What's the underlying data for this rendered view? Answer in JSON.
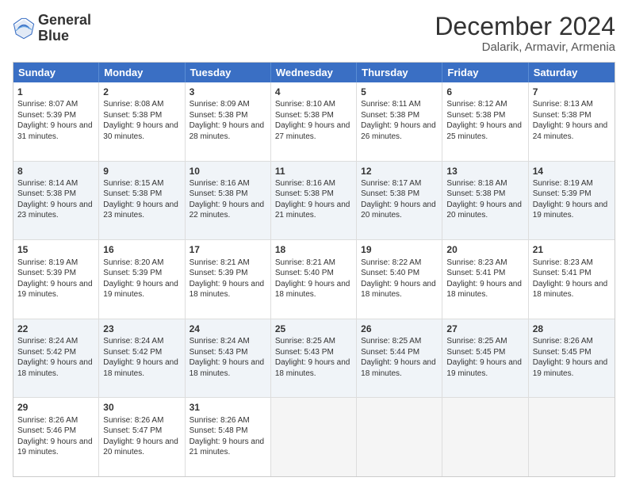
{
  "header": {
    "logo_line1": "General",
    "logo_line2": "Blue",
    "main_title": "December 2024",
    "subtitle": "Dalarik, Armavir, Armenia"
  },
  "calendar": {
    "days_of_week": [
      "Sunday",
      "Monday",
      "Tuesday",
      "Wednesday",
      "Thursday",
      "Friday",
      "Saturday"
    ],
    "rows": [
      [
        {
          "day": "1",
          "sunrise": "Sunrise: 8:07 AM",
          "sunset": "Sunset: 5:39 PM",
          "daylight": "Daylight: 9 hours and 31 minutes."
        },
        {
          "day": "2",
          "sunrise": "Sunrise: 8:08 AM",
          "sunset": "Sunset: 5:38 PM",
          "daylight": "Daylight: 9 hours and 30 minutes."
        },
        {
          "day": "3",
          "sunrise": "Sunrise: 8:09 AM",
          "sunset": "Sunset: 5:38 PM",
          "daylight": "Daylight: 9 hours and 28 minutes."
        },
        {
          "day": "4",
          "sunrise": "Sunrise: 8:10 AM",
          "sunset": "Sunset: 5:38 PM",
          "daylight": "Daylight: 9 hours and 27 minutes."
        },
        {
          "day": "5",
          "sunrise": "Sunrise: 8:11 AM",
          "sunset": "Sunset: 5:38 PM",
          "daylight": "Daylight: 9 hours and 26 minutes."
        },
        {
          "day": "6",
          "sunrise": "Sunrise: 8:12 AM",
          "sunset": "Sunset: 5:38 PM",
          "daylight": "Daylight: 9 hours and 25 minutes."
        },
        {
          "day": "7",
          "sunrise": "Sunrise: 8:13 AM",
          "sunset": "Sunset: 5:38 PM",
          "daylight": "Daylight: 9 hours and 24 minutes."
        }
      ],
      [
        {
          "day": "8",
          "sunrise": "Sunrise: 8:14 AM",
          "sunset": "Sunset: 5:38 PM",
          "daylight": "Daylight: 9 hours and 23 minutes."
        },
        {
          "day": "9",
          "sunrise": "Sunrise: 8:15 AM",
          "sunset": "Sunset: 5:38 PM",
          "daylight": "Daylight: 9 hours and 23 minutes."
        },
        {
          "day": "10",
          "sunrise": "Sunrise: 8:16 AM",
          "sunset": "Sunset: 5:38 PM",
          "daylight": "Daylight: 9 hours and 22 minutes."
        },
        {
          "day": "11",
          "sunrise": "Sunrise: 8:16 AM",
          "sunset": "Sunset: 5:38 PM",
          "daylight": "Daylight: 9 hours and 21 minutes."
        },
        {
          "day": "12",
          "sunrise": "Sunrise: 8:17 AM",
          "sunset": "Sunset: 5:38 PM",
          "daylight": "Daylight: 9 hours and 20 minutes."
        },
        {
          "day": "13",
          "sunrise": "Sunrise: 8:18 AM",
          "sunset": "Sunset: 5:38 PM",
          "daylight": "Daylight: 9 hours and 20 minutes."
        },
        {
          "day": "14",
          "sunrise": "Sunrise: 8:19 AM",
          "sunset": "Sunset: 5:39 PM",
          "daylight": "Daylight: 9 hours and 19 minutes."
        }
      ],
      [
        {
          "day": "15",
          "sunrise": "Sunrise: 8:19 AM",
          "sunset": "Sunset: 5:39 PM",
          "daylight": "Daylight: 9 hours and 19 minutes."
        },
        {
          "day": "16",
          "sunrise": "Sunrise: 8:20 AM",
          "sunset": "Sunset: 5:39 PM",
          "daylight": "Daylight: 9 hours and 19 minutes."
        },
        {
          "day": "17",
          "sunrise": "Sunrise: 8:21 AM",
          "sunset": "Sunset: 5:39 PM",
          "daylight": "Daylight: 9 hours and 18 minutes."
        },
        {
          "day": "18",
          "sunrise": "Sunrise: 8:21 AM",
          "sunset": "Sunset: 5:40 PM",
          "daylight": "Daylight: 9 hours and 18 minutes."
        },
        {
          "day": "19",
          "sunrise": "Sunrise: 8:22 AM",
          "sunset": "Sunset: 5:40 PM",
          "daylight": "Daylight: 9 hours and 18 minutes."
        },
        {
          "day": "20",
          "sunrise": "Sunrise: 8:23 AM",
          "sunset": "Sunset: 5:41 PM",
          "daylight": "Daylight: 9 hours and 18 minutes."
        },
        {
          "day": "21",
          "sunrise": "Sunrise: 8:23 AM",
          "sunset": "Sunset: 5:41 PM",
          "daylight": "Daylight: 9 hours and 18 minutes."
        }
      ],
      [
        {
          "day": "22",
          "sunrise": "Sunrise: 8:24 AM",
          "sunset": "Sunset: 5:42 PM",
          "daylight": "Daylight: 9 hours and 18 minutes."
        },
        {
          "day": "23",
          "sunrise": "Sunrise: 8:24 AM",
          "sunset": "Sunset: 5:42 PM",
          "daylight": "Daylight: 9 hours and 18 minutes."
        },
        {
          "day": "24",
          "sunrise": "Sunrise: 8:24 AM",
          "sunset": "Sunset: 5:43 PM",
          "daylight": "Daylight: 9 hours and 18 minutes."
        },
        {
          "day": "25",
          "sunrise": "Sunrise: 8:25 AM",
          "sunset": "Sunset: 5:43 PM",
          "daylight": "Daylight: 9 hours and 18 minutes."
        },
        {
          "day": "26",
          "sunrise": "Sunrise: 8:25 AM",
          "sunset": "Sunset: 5:44 PM",
          "daylight": "Daylight: 9 hours and 18 minutes."
        },
        {
          "day": "27",
          "sunrise": "Sunrise: 8:25 AM",
          "sunset": "Sunset: 5:45 PM",
          "daylight": "Daylight: 9 hours and 19 minutes."
        },
        {
          "day": "28",
          "sunrise": "Sunrise: 8:26 AM",
          "sunset": "Sunset: 5:45 PM",
          "daylight": "Daylight: 9 hours and 19 minutes."
        }
      ],
      [
        {
          "day": "29",
          "sunrise": "Sunrise: 8:26 AM",
          "sunset": "Sunset: 5:46 PM",
          "daylight": "Daylight: 9 hours and 19 minutes."
        },
        {
          "day": "30",
          "sunrise": "Sunrise: 8:26 AM",
          "sunset": "Sunset: 5:47 PM",
          "daylight": "Daylight: 9 hours and 20 minutes."
        },
        {
          "day": "31",
          "sunrise": "Sunrise: 8:26 AM",
          "sunset": "Sunset: 5:48 PM",
          "daylight": "Daylight: 9 hours and 21 minutes."
        },
        {
          "day": "",
          "sunrise": "",
          "sunset": "",
          "daylight": ""
        },
        {
          "day": "",
          "sunrise": "",
          "sunset": "",
          "daylight": ""
        },
        {
          "day": "",
          "sunrise": "",
          "sunset": "",
          "daylight": ""
        },
        {
          "day": "",
          "sunrise": "",
          "sunset": "",
          "daylight": ""
        }
      ]
    ]
  }
}
